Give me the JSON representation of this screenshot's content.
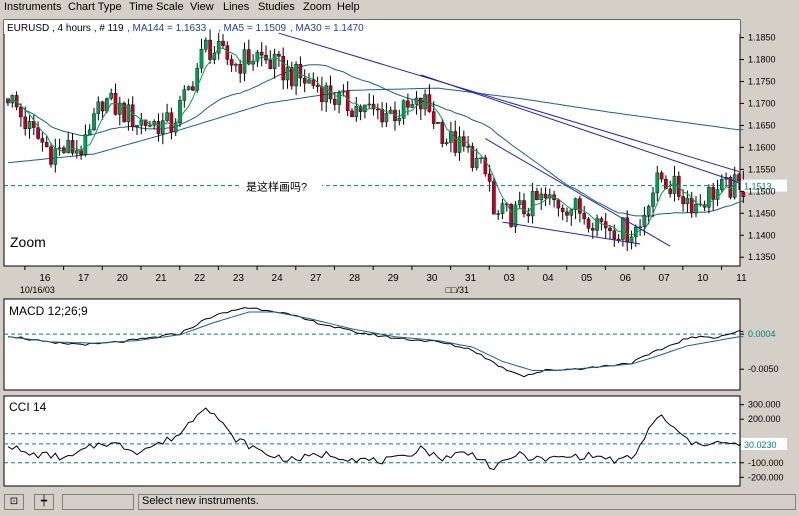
{
  "menu": [
    "Instruments",
    "Chart Type",
    "Time Scale",
    "View",
    "Lines",
    "Studies",
    "Zoom",
    "Help"
  ],
  "status": {
    "text": "Select new instruments."
  },
  "colors": {
    "bg": "#ffffff",
    "frame": "#000000",
    "up": "#00a050",
    "down": "#c00020",
    "trend": "#2020c0",
    "ma": "#1a6090",
    "dash": "#008080",
    "label": "#2040a0"
  },
  "chart_data": [
    {
      "type": "candlestick",
      "header": {
        "symbol": "EURUSD",
        "timeframe": "4 hours",
        "count": "# 119",
        "indicators": [
          {
            "label": "MA144 = 1.1633"
          },
          {
            "label": "MA5 = 1.1509"
          },
          {
            "label": "MA30 = 1.1470"
          }
        ]
      },
      "ylim": [
        1.133,
        1.189
      ],
      "yticks": [
        1.185,
        1.18,
        1.175,
        1.17,
        1.165,
        1.16,
        1.155,
        1.15,
        1.145,
        1.14,
        1.135
      ],
      "xticks": [
        {
          "i": 3,
          "label": "16"
        },
        {
          "i": 12,
          "label": "17"
        },
        {
          "i": 21,
          "label": "20"
        },
        {
          "i": 30,
          "label": "21"
        },
        {
          "i": 39,
          "label": "22"
        },
        {
          "i": 48,
          "label": "23"
        },
        {
          "i": 57,
          "label": "24"
        },
        {
          "i": 66,
          "label": "27"
        },
        {
          "i": 75,
          "label": "28"
        },
        {
          "i": 84,
          "label": "29"
        },
        {
          "i": 93,
          "label": "30"
        },
        {
          "i": 102,
          "label": "31"
        },
        {
          "i": 111,
          "label": "03"
        },
        {
          "i": 120,
          "label": "04"
        },
        {
          "i": 129,
          "label": "05"
        },
        {
          "i": 138,
          "label": "06"
        },
        {
          "i": 147,
          "label": "07"
        },
        {
          "i": 156,
          "label": "10"
        },
        {
          "i": 165,
          "label": "11"
        }
      ],
      "date_labels": [
        {
          "i": 3,
          "text": "10/16/03"
        },
        {
          "i": 102,
          "text": "□□/31"
        }
      ],
      "zoom_label": "Zoom",
      "annotation": "是这样画吗?",
      "hline": {
        "value": 1.1513,
        "label": "1.1513"
      },
      "trendlines": [
        {
          "from": [
            63,
            1.186
          ],
          "to": [
            170,
            1.1545
          ]
        },
        {
          "from": [
            96,
            1.1765
          ],
          "to": [
            170,
            1.152
          ]
        },
        {
          "from": [
            111,
            1.162
          ],
          "to": [
            154,
            1.1375
          ]
        },
        {
          "from": [
            115,
            1.143
          ],
          "to": [
            147,
            1.138
          ]
        }
      ],
      "knots": [
        [
          0,
          1.172
        ],
        [
          5,
          1.164
        ],
        [
          10,
          1.159
        ],
        [
          18,
          1.16
        ],
        [
          22,
          1.171
        ],
        [
          30,
          1.166
        ],
        [
          38,
          1.165
        ],
        [
          42,
          1.173
        ],
        [
          46,
          1.183
        ],
        [
          53,
          1.179
        ],
        [
          58,
          1.181
        ],
        [
          63,
          1.178
        ],
        [
          67,
          1.176
        ],
        [
          72,
          1.174
        ],
        [
          78,
          1.17
        ],
        [
          85,
          1.168
        ],
        [
          92,
          1.168
        ],
        [
          97,
          1.17
        ],
        [
          102,
          1.162
        ],
        [
          108,
          1.158
        ],
        [
          112,
          1.152
        ],
        [
          113,
          1.144
        ],
        [
          118,
          1.145
        ],
        [
          124,
          1.148
        ],
        [
          130,
          1.147
        ],
        [
          136,
          1.144
        ],
        [
          140,
          1.142
        ],
        [
          144,
          1.141
        ],
        [
          147,
          1.142
        ],
        [
          149,
          1.149
        ],
        [
          152,
          1.153
        ],
        [
          157,
          1.149
        ],
        [
          160,
          1.147
        ],
        [
          164,
          1.15
        ],
        [
          169,
          1.151
        ]
      ]
    },
    {
      "type": "line",
      "title": "MACD 12;26;9",
      "ylim": [
        -0.0082,
        0.0058
      ],
      "yticks": [
        {
          "v": 0.0004,
          "label": "0.0004"
        },
        {
          "v": -0.005,
          "label": "-0.0050"
        }
      ],
      "hline": {
        "value": 0.0004
      },
      "series": [
        {
          "knots": [
            [
              0,
              0.0002
            ],
            [
              10,
              -0.001
            ],
            [
              20,
              -0.0012
            ],
            [
              30,
              -0.0005
            ],
            [
              40,
              0.0005
            ],
            [
              47,
              0.003
            ],
            [
              55,
              0.0045
            ],
            [
              62,
              0.004
            ],
            [
              70,
              0.0025
            ],
            [
              80,
              0.0008
            ],
            [
              90,
              -0.0002
            ],
            [
              100,
              -0.0008
            ],
            [
              108,
              -0.002
            ],
            [
              115,
              -0.0048
            ],
            [
              120,
              -0.006
            ],
            [
              125,
              -0.0052
            ],
            [
              135,
              -0.0048
            ],
            [
              145,
              -0.004
            ],
            [
              150,
              -0.0025
            ],
            [
              158,
              -0.0002
            ],
            [
              165,
              0.0
            ],
            [
              170,
              0.0008
            ]
          ]
        },
        {
          "knots": [
            [
              0,
              0.0
            ],
            [
              10,
              -0.0008
            ],
            [
              20,
              -0.001
            ],
            [
              30,
              -0.0006
            ],
            [
              40,
              0.0003
            ],
            [
              48,
              0.0022
            ],
            [
              56,
              0.0038
            ],
            [
              62,
              0.0038
            ],
            [
              70,
              0.0028
            ],
            [
              80,
              0.0012
            ],
            [
              90,
              0.0
            ],
            [
              100,
              -0.0006
            ],
            [
              108,
              -0.0016
            ],
            [
              115,
              -0.0038
            ],
            [
              122,
              -0.0052
            ],
            [
              128,
              -0.0052
            ],
            [
              135,
              -0.0048
            ],
            [
              145,
              -0.0042
            ],
            [
              150,
              -0.0032
            ],
            [
              158,
              -0.0014
            ],
            [
              165,
              -0.0006
            ],
            [
              170,
              0.0
            ]
          ]
        }
      ]
    },
    {
      "type": "line",
      "title": "CCI 14",
      "ylim": [
        -260,
        360
      ],
      "yticks": [
        {
          "v": 300,
          "label": "300.000"
        },
        {
          "v": 200,
          "label": "200.000"
        },
        {
          "v": -100,
          "label": "-100.000"
        },
        {
          "v": -200,
          "label": "-200.000"
        }
      ],
      "hline": {
        "value": 30.023,
        "label": "30.0230"
      },
      "ref_lines": [
        -100,
        100
      ],
      "series": [
        {
          "knots": [
            [
              0,
              30
            ],
            [
              4,
              -40
            ],
            [
              10,
              -50
            ],
            [
              14,
              -70
            ],
            [
              18,
              -10
            ],
            [
              22,
              40
            ],
            [
              26,
              20
            ],
            [
              30,
              -20
            ],
            [
              36,
              40
            ],
            [
              40,
              100
            ],
            [
              44,
              240
            ],
            [
              46,
              300
            ],
            [
              49,
              200
            ],
            [
              52,
              80
            ],
            [
              56,
              20
            ],
            [
              60,
              -40
            ],
            [
              66,
              -80
            ],
            [
              70,
              -60
            ],
            [
              74,
              -40
            ],
            [
              80,
              -70
            ],
            [
              86,
              -90
            ],
            [
              92,
              -70
            ],
            [
              96,
              10
            ],
            [
              100,
              -70
            ],
            [
              106,
              -30
            ],
            [
              110,
              -60
            ],
            [
              113,
              -150
            ],
            [
              118,
              -40
            ],
            [
              124,
              -80
            ],
            [
              130,
              -60
            ],
            [
              136,
              -50
            ],
            [
              142,
              -90
            ],
            [
              146,
              -50
            ],
            [
              149,
              140
            ],
            [
              152,
              220
            ],
            [
              156,
              100
            ],
            [
              160,
              20
            ],
            [
              164,
              50
            ],
            [
              168,
              20
            ],
            [
              170,
              30
            ]
          ]
        }
      ]
    }
  ]
}
